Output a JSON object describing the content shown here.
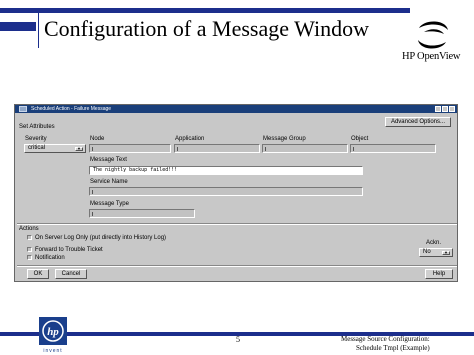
{
  "slide": {
    "title": "Configuration of a Message Window",
    "brand": "HP OpenView",
    "page_number": "5",
    "footer_line1": "Message Source Configuration:",
    "footer_line2": "Schedule Tmpl (Example)",
    "badge_text": "invent"
  },
  "colors": {
    "slide_accent": "#1c2e8c",
    "window_bg": "#c8c8c8",
    "titlebar": "#1a3f7a"
  },
  "window": {
    "title": "Scheduled Action - Failure Message",
    "set_attributes_label": "Set Attributes",
    "advanced_options_label": "Advanced Options...",
    "severity": {
      "label": "Severity",
      "value": "critical"
    },
    "node_label": "Node",
    "application_label": "Application",
    "message_group_label": "Message Group",
    "object_label": "Object",
    "message_text": {
      "label": "Message Text",
      "value": "The nightly backup failed!!!"
    },
    "service_name_label": "Service Name",
    "message_type_label": "Message Type",
    "actions_label": "Actions",
    "on_server_log_label": "On Server Log Only (put directly into History Log)",
    "forward_label": "Forward to Trouble Ticket",
    "notification_label": "Notification",
    "ackn": {
      "label": "Ackn.",
      "value": "No"
    },
    "ok_label": "OK",
    "cancel_label": "Cancel",
    "help_label": "Help"
  }
}
